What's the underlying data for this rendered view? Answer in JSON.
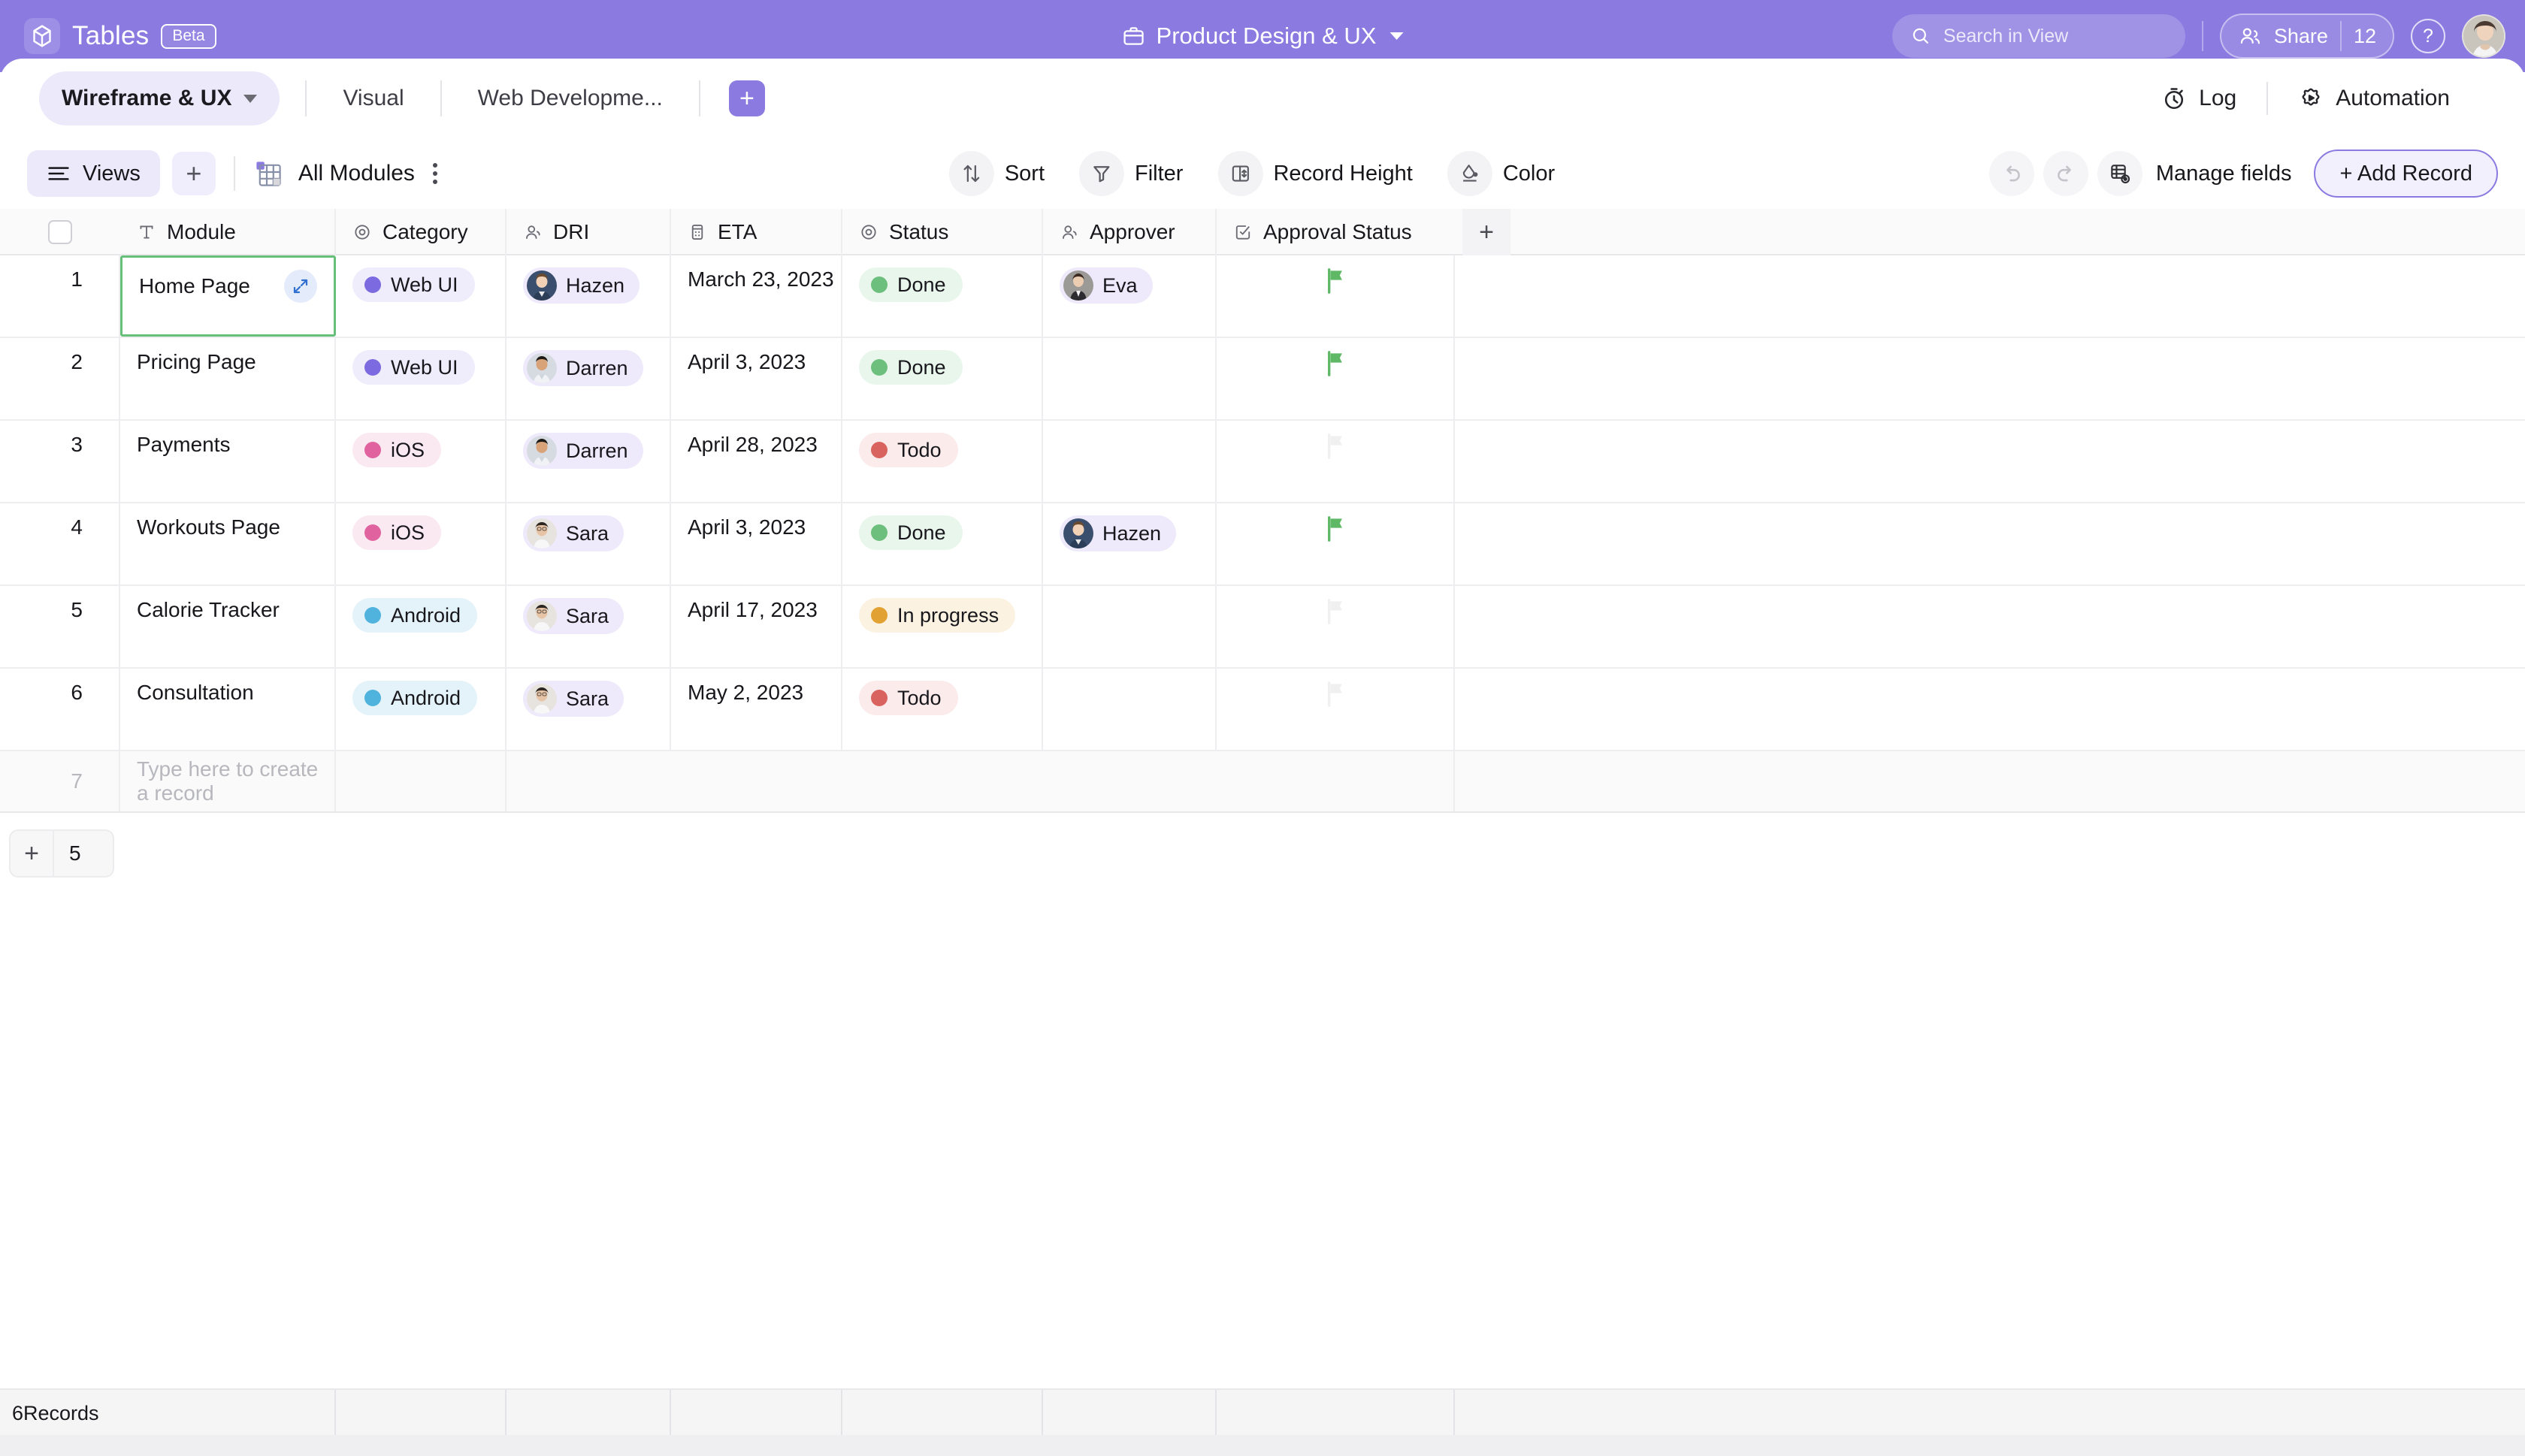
{
  "topbar": {
    "brand_logo_icon": "cube-logo-icon",
    "brand_name": "Tables",
    "beta_label": "Beta",
    "workspace_icon": "briefcase-icon",
    "workspace_name": "Product Design & UX",
    "search_icon": "search-icon",
    "search_placeholder": "Search in View",
    "search_value": "",
    "share_icon": "people-icon",
    "share_label": "Share",
    "share_count": "12",
    "help_label": "?",
    "avatar_name": "user-avatar",
    "bg_color": "#8b7ae0"
  },
  "tabbar": {
    "tabs": [
      {
        "label": "Wireframe & UX",
        "active": true
      },
      {
        "label": "Visual",
        "active": false
      },
      {
        "label": "Web Developme...",
        "active": false
      }
    ],
    "add_tab_label": "+",
    "log_icon": "stopwatch-icon",
    "log_label": "Log",
    "automation_icon": "gear-play-icon",
    "automation_label": "Automation"
  },
  "toolbar": {
    "views_icon": "list-lines-icon",
    "views_label": "Views",
    "views_add_label": "+",
    "grid_icon": "grid-table-icon",
    "current_view": "All Modules",
    "kebab_icon": "more-vertical-icon",
    "center_buttons": [
      {
        "label": "Sort",
        "icon": "sort-arrows-icon"
      },
      {
        "label": "Filter",
        "icon": "funnel-icon"
      },
      {
        "label": "Record Height",
        "icon": "record-height-icon"
      },
      {
        "label": "Color",
        "icon": "paint-drop-icon"
      }
    ],
    "undo_icon": "undo-icon",
    "redo_icon": "redo-icon",
    "manage_fields_icon": "manage-fields-icon",
    "manage_fields_label": "Manage fields",
    "add_record_label": "+ Add Record",
    "accent_color": "#8b7ae0"
  },
  "grid": {
    "columns": [
      {
        "key": "check",
        "label": "",
        "icon": "checkbox-icon"
      },
      {
        "key": "module",
        "label": "Module",
        "icon": "text-field-icon"
      },
      {
        "key": "category",
        "label": "Category",
        "icon": "single-select-icon"
      },
      {
        "key": "dri",
        "label": "DRI",
        "icon": "user-icon"
      },
      {
        "key": "eta",
        "label": "ETA",
        "icon": "date-icon"
      },
      {
        "key": "status",
        "label": "Status",
        "icon": "single-select-icon"
      },
      {
        "key": "approver",
        "label": "Approver",
        "icon": "user-icon"
      },
      {
        "key": "approval_status",
        "label": "Approval Status",
        "icon": "checkbox-checked-icon"
      }
    ],
    "add_column_label": "+",
    "rows": [
      {
        "num": "1",
        "module": "Home Page",
        "selected": true,
        "category": "Web UI",
        "category_color": "#7c6ae0",
        "category_bg": "#efecfc",
        "dri": "Hazen",
        "eta": "March 23, 2023",
        "status": "Done",
        "status_color": "#6cbf7d",
        "status_bg": "#e9f6ec",
        "approver": "Eva",
        "approval_flag": "flagged"
      },
      {
        "num": "2",
        "module": "Pricing Page",
        "selected": false,
        "category": "Web UI",
        "category_color": "#7c6ae0",
        "category_bg": "#efecfc",
        "dri": "Darren",
        "eta": "April 3, 2023",
        "status": "Done",
        "status_color": "#6cbf7d",
        "status_bg": "#e9f6ec",
        "approver": "",
        "approval_flag": "flagged"
      },
      {
        "num": "3",
        "module": "Payments",
        "selected": false,
        "category": "iOS",
        "category_color": "#e0629e",
        "category_bg": "#fbe9f2",
        "dri": "Darren",
        "eta": "April 28, 2023",
        "status": "Todo",
        "status_color": "#d9635f",
        "status_bg": "#fbebeb",
        "approver": "",
        "approval_flag": "empty"
      },
      {
        "num": "4",
        "module": "Workouts Page",
        "selected": false,
        "category": "iOS",
        "category_color": "#e0629e",
        "category_bg": "#fbe9f2",
        "dri": "Sara",
        "eta": "April 3, 2023",
        "status": "Done",
        "status_color": "#6cbf7d",
        "status_bg": "#e9f6ec",
        "approver": "Hazen",
        "approval_flag": "flagged"
      },
      {
        "num": "5",
        "module": "Calorie Tracker",
        "selected": false,
        "category": "Android",
        "category_color": "#4fb3dd",
        "category_bg": "#e4f3fa",
        "dri": "Sara",
        "eta": "April 17, 2023",
        "status": "In progress",
        "status_color": "#e2a233",
        "status_bg": "#fcf2e2",
        "approver": "",
        "approval_flag": "empty"
      },
      {
        "num": "6",
        "module": "Consultation",
        "selected": false,
        "category": "Android",
        "category_color": "#4fb3dd",
        "category_bg": "#e4f3fa",
        "dri": "Sara",
        "eta": "May 2, 2023",
        "status": "Todo",
        "status_color": "#d9635f",
        "status_bg": "#fbebeb",
        "approver": "",
        "approval_flag": "empty"
      }
    ],
    "new_row": {
      "num": "7",
      "placeholder": "Type here to create a record"
    },
    "add_rows_plus": "+",
    "add_rows_count": "5",
    "flag_color_on": "#5fb866",
    "flag_color_off": "#f0f0f1",
    "expand_icon": "expand-arrows-icon",
    "selection_color": "#67c07a"
  },
  "footer": {
    "record_count_label": "6Records"
  }
}
